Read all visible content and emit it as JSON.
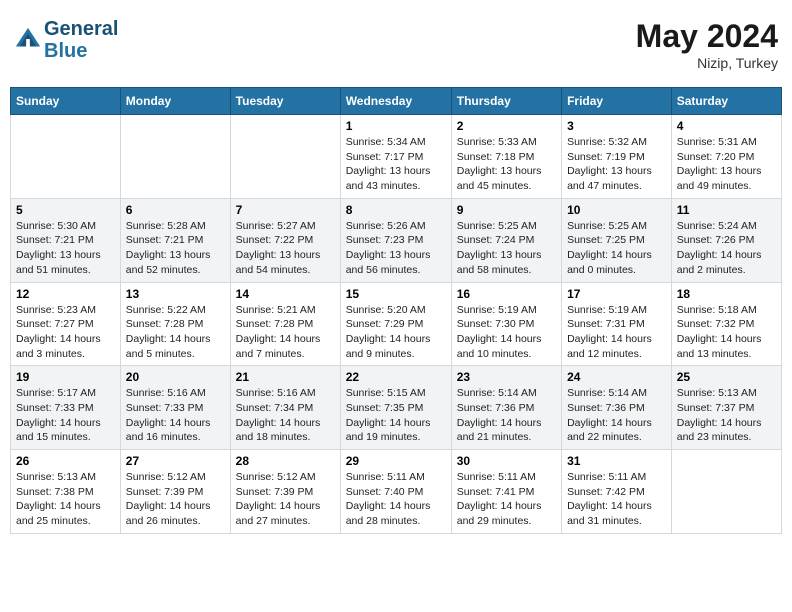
{
  "header": {
    "logo_line1": "General",
    "logo_line2": "Blue",
    "month": "May 2024",
    "location": "Nizip, Turkey"
  },
  "weekdays": [
    "Sunday",
    "Monday",
    "Tuesday",
    "Wednesday",
    "Thursday",
    "Friday",
    "Saturday"
  ],
  "weeks": [
    [
      {
        "day": "",
        "sunrise": "",
        "sunset": "",
        "daylight": ""
      },
      {
        "day": "",
        "sunrise": "",
        "sunset": "",
        "daylight": ""
      },
      {
        "day": "",
        "sunrise": "",
        "sunset": "",
        "daylight": ""
      },
      {
        "day": "1",
        "sunrise": "Sunrise: 5:34 AM",
        "sunset": "Sunset: 7:17 PM",
        "daylight": "Daylight: 13 hours and 43 minutes."
      },
      {
        "day": "2",
        "sunrise": "Sunrise: 5:33 AM",
        "sunset": "Sunset: 7:18 PM",
        "daylight": "Daylight: 13 hours and 45 minutes."
      },
      {
        "day": "3",
        "sunrise": "Sunrise: 5:32 AM",
        "sunset": "Sunset: 7:19 PM",
        "daylight": "Daylight: 13 hours and 47 minutes."
      },
      {
        "day": "4",
        "sunrise": "Sunrise: 5:31 AM",
        "sunset": "Sunset: 7:20 PM",
        "daylight": "Daylight: 13 hours and 49 minutes."
      }
    ],
    [
      {
        "day": "5",
        "sunrise": "Sunrise: 5:30 AM",
        "sunset": "Sunset: 7:21 PM",
        "daylight": "Daylight: 13 hours and 51 minutes."
      },
      {
        "day": "6",
        "sunrise": "Sunrise: 5:28 AM",
        "sunset": "Sunset: 7:21 PM",
        "daylight": "Daylight: 13 hours and 52 minutes."
      },
      {
        "day": "7",
        "sunrise": "Sunrise: 5:27 AM",
        "sunset": "Sunset: 7:22 PM",
        "daylight": "Daylight: 13 hours and 54 minutes."
      },
      {
        "day": "8",
        "sunrise": "Sunrise: 5:26 AM",
        "sunset": "Sunset: 7:23 PM",
        "daylight": "Daylight: 13 hours and 56 minutes."
      },
      {
        "day": "9",
        "sunrise": "Sunrise: 5:25 AM",
        "sunset": "Sunset: 7:24 PM",
        "daylight": "Daylight: 13 hours and 58 minutes."
      },
      {
        "day": "10",
        "sunrise": "Sunrise: 5:25 AM",
        "sunset": "Sunset: 7:25 PM",
        "daylight": "Daylight: 14 hours and 0 minutes."
      },
      {
        "day": "11",
        "sunrise": "Sunrise: 5:24 AM",
        "sunset": "Sunset: 7:26 PM",
        "daylight": "Daylight: 14 hours and 2 minutes."
      }
    ],
    [
      {
        "day": "12",
        "sunrise": "Sunrise: 5:23 AM",
        "sunset": "Sunset: 7:27 PM",
        "daylight": "Daylight: 14 hours and 3 minutes."
      },
      {
        "day": "13",
        "sunrise": "Sunrise: 5:22 AM",
        "sunset": "Sunset: 7:28 PM",
        "daylight": "Daylight: 14 hours and 5 minutes."
      },
      {
        "day": "14",
        "sunrise": "Sunrise: 5:21 AM",
        "sunset": "Sunset: 7:28 PM",
        "daylight": "Daylight: 14 hours and 7 minutes."
      },
      {
        "day": "15",
        "sunrise": "Sunrise: 5:20 AM",
        "sunset": "Sunset: 7:29 PM",
        "daylight": "Daylight: 14 hours and 9 minutes."
      },
      {
        "day": "16",
        "sunrise": "Sunrise: 5:19 AM",
        "sunset": "Sunset: 7:30 PM",
        "daylight": "Daylight: 14 hours and 10 minutes."
      },
      {
        "day": "17",
        "sunrise": "Sunrise: 5:19 AM",
        "sunset": "Sunset: 7:31 PM",
        "daylight": "Daylight: 14 hours and 12 minutes."
      },
      {
        "day": "18",
        "sunrise": "Sunrise: 5:18 AM",
        "sunset": "Sunset: 7:32 PM",
        "daylight": "Daylight: 14 hours and 13 minutes."
      }
    ],
    [
      {
        "day": "19",
        "sunrise": "Sunrise: 5:17 AM",
        "sunset": "Sunset: 7:33 PM",
        "daylight": "Daylight: 14 hours and 15 minutes."
      },
      {
        "day": "20",
        "sunrise": "Sunrise: 5:16 AM",
        "sunset": "Sunset: 7:33 PM",
        "daylight": "Daylight: 14 hours and 16 minutes."
      },
      {
        "day": "21",
        "sunrise": "Sunrise: 5:16 AM",
        "sunset": "Sunset: 7:34 PM",
        "daylight": "Daylight: 14 hours and 18 minutes."
      },
      {
        "day": "22",
        "sunrise": "Sunrise: 5:15 AM",
        "sunset": "Sunset: 7:35 PM",
        "daylight": "Daylight: 14 hours and 19 minutes."
      },
      {
        "day": "23",
        "sunrise": "Sunrise: 5:14 AM",
        "sunset": "Sunset: 7:36 PM",
        "daylight": "Daylight: 14 hours and 21 minutes."
      },
      {
        "day": "24",
        "sunrise": "Sunrise: 5:14 AM",
        "sunset": "Sunset: 7:36 PM",
        "daylight": "Daylight: 14 hours and 22 minutes."
      },
      {
        "day": "25",
        "sunrise": "Sunrise: 5:13 AM",
        "sunset": "Sunset: 7:37 PM",
        "daylight": "Daylight: 14 hours and 23 minutes."
      }
    ],
    [
      {
        "day": "26",
        "sunrise": "Sunrise: 5:13 AM",
        "sunset": "Sunset: 7:38 PM",
        "daylight": "Daylight: 14 hours and 25 minutes."
      },
      {
        "day": "27",
        "sunrise": "Sunrise: 5:12 AM",
        "sunset": "Sunset: 7:39 PM",
        "daylight": "Daylight: 14 hours and 26 minutes."
      },
      {
        "day": "28",
        "sunrise": "Sunrise: 5:12 AM",
        "sunset": "Sunset: 7:39 PM",
        "daylight": "Daylight: 14 hours and 27 minutes."
      },
      {
        "day": "29",
        "sunrise": "Sunrise: 5:11 AM",
        "sunset": "Sunset: 7:40 PM",
        "daylight": "Daylight: 14 hours and 28 minutes."
      },
      {
        "day": "30",
        "sunrise": "Sunrise: 5:11 AM",
        "sunset": "Sunset: 7:41 PM",
        "daylight": "Daylight: 14 hours and 29 minutes."
      },
      {
        "day": "31",
        "sunrise": "Sunrise: 5:11 AM",
        "sunset": "Sunset: 7:42 PM",
        "daylight": "Daylight: 14 hours and 31 minutes."
      },
      {
        "day": "",
        "sunrise": "",
        "sunset": "",
        "daylight": ""
      }
    ]
  ]
}
